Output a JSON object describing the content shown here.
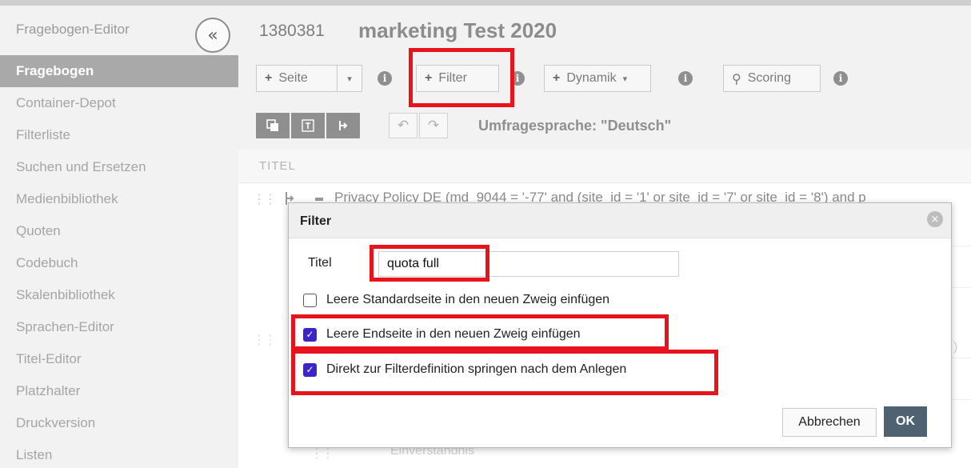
{
  "sidebar": {
    "title": "Fragebogen-Editor",
    "collapse_icon": "«",
    "items": [
      {
        "label": "Fragebogen",
        "active": true
      },
      {
        "label": "Container-Depot"
      },
      {
        "label": "Filterliste"
      },
      {
        "label": "Suchen und Ersetzen"
      },
      {
        "label": "Medienbibliothek"
      },
      {
        "label": "Quoten"
      },
      {
        "label": "Codebuch"
      },
      {
        "label": "Skalenbibliothek"
      },
      {
        "label": "Sprachen-Editor"
      },
      {
        "label": "Titel-Editor"
      },
      {
        "label": "Platzhalter"
      },
      {
        "label": "Druckversion"
      },
      {
        "label": "Listen"
      }
    ]
  },
  "header": {
    "project_id": "1380381",
    "project_name": "marketing Test 2020"
  },
  "toolbar": {
    "seite_label": "Seite",
    "filter_label": "Filter",
    "dynamik_label": "Dynamik",
    "scoring_label": "Scoring",
    "plus": "+",
    "caret": "▾",
    "info": "i",
    "scoring_icon": "⚲"
  },
  "toolbar2": {
    "language_label": "Umfragesprache: \"Deutsch\"",
    "undo_icon": "↶",
    "redo_icon": "↷"
  },
  "table": {
    "column_title": "TITEL",
    "row1_text": "Privacy Policy DE (md_9044 = '-77' and (site_id = '1' or site_id = '7' or site_id = '8') and p",
    "bg_right_1": ")",
    "bg_bottom": "Einverständnis"
  },
  "dialog": {
    "title": "Filter",
    "close_icon": "×",
    "title_label": "Titel",
    "title_value": "quota full",
    "checkboxes": [
      {
        "label": "Leere Standardseite in den neuen Zweig einfügen",
        "checked": false
      },
      {
        "label": "Leere Endseite in den neuen Zweig einfügen",
        "checked": true
      },
      {
        "label": "Direkt zur Filterdefinition springen nach dem Anlegen",
        "checked": true
      }
    ],
    "check_mark": "✓",
    "cancel_label": "Abbrechen",
    "ok_label": "OK"
  },
  "colors": {
    "highlight": "#e8131c",
    "checkbox_checked": "#3b24c8",
    "ok_button": "#4f6271"
  }
}
